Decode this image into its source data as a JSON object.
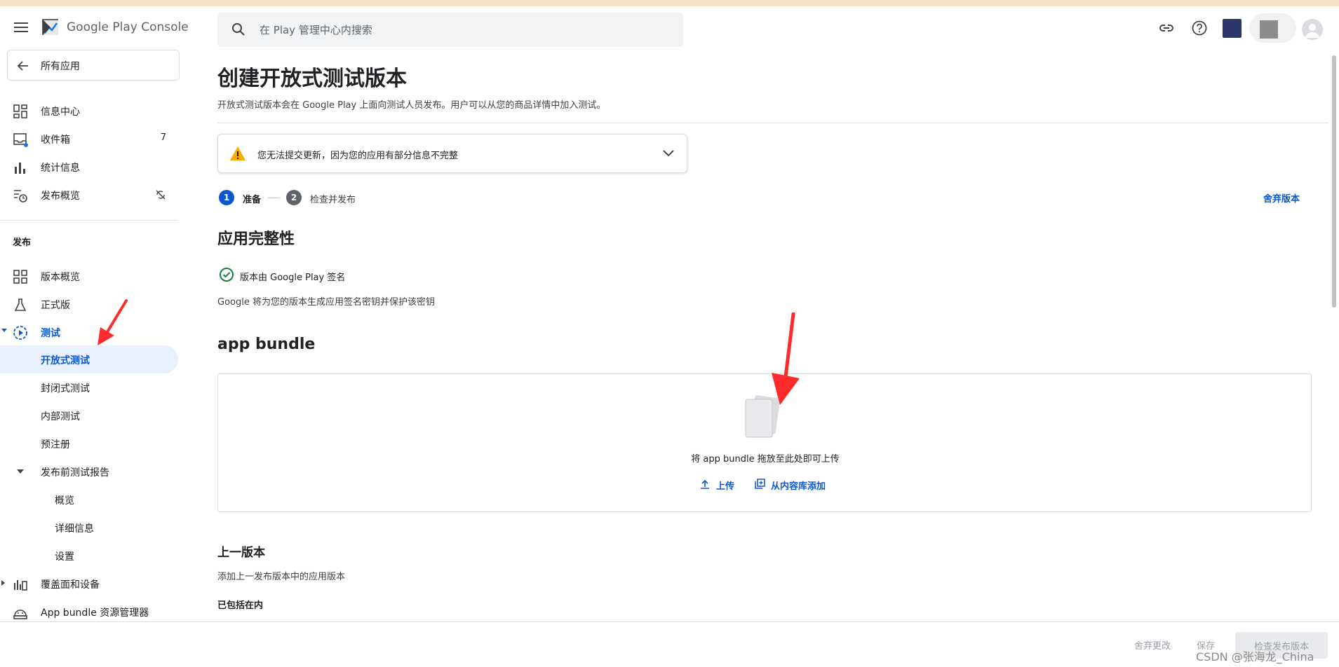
{
  "header": {
    "app_name": "Google Play Console",
    "search_placeholder": "在 Play 管理中心内搜索"
  },
  "sidebar": {
    "back_label": "所有应用",
    "items_top": [
      {
        "label": "信息中心"
      },
      {
        "label": "收件箱",
        "count": "7"
      },
      {
        "label": "统计信息"
      },
      {
        "label": "发布概览"
      }
    ],
    "section_release": "发布",
    "release_items": [
      {
        "label": "版本概览"
      },
      {
        "label": "正式版"
      },
      {
        "label": "测试"
      },
      {
        "label": "开放式测试"
      },
      {
        "label": "封闭式测试"
      },
      {
        "label": "内部测试"
      },
      {
        "label": "预注册"
      },
      {
        "label": "发布前测试报告"
      },
      {
        "label": "概览"
      },
      {
        "label": "详细信息"
      },
      {
        "label": "设置"
      },
      {
        "label": "覆盖面和设备"
      },
      {
        "label": "App bundle 资源管理器"
      }
    ]
  },
  "main": {
    "title": "创建开放式测试版本",
    "subtitle": "开放式测试版本会在 Google Play 上面向测试人员发布。用户可以从您的商品详情中加入测试。",
    "warning": "您无法提交更新，因为您的应用有部分信息不完整",
    "steps": [
      {
        "num": "1",
        "label": "准备"
      },
      {
        "num": "2",
        "label": "检查并发布"
      }
    ],
    "discard_release": "舍弃版本",
    "integrity_title": "应用完整性",
    "signed_by": "版本由 Google Play 签名",
    "signed_desc": "Google 将为您的版本生成应用签名密钥并保护该密钥",
    "bundle_title": "app bundle",
    "drop_text": "将 app bundle 拖放至此处即可上传",
    "upload_label": "上传",
    "library_label": "从内容库添加",
    "prev_title": "上一版本",
    "prev_desc": "添加上一发布版本中的应用版本",
    "included": "已包括在内"
  },
  "footer": {
    "discard_changes": "舍弃更改",
    "save": "保存",
    "review": "检查发布版本"
  },
  "watermark": "CSDN @张海龙_China",
  "colors": {
    "accent": "#0b57d0",
    "active_bg": "#e8f0fe",
    "warning": "#f9ab00",
    "success": "#188038",
    "annotation_arrow": "#ff2a2a"
  }
}
